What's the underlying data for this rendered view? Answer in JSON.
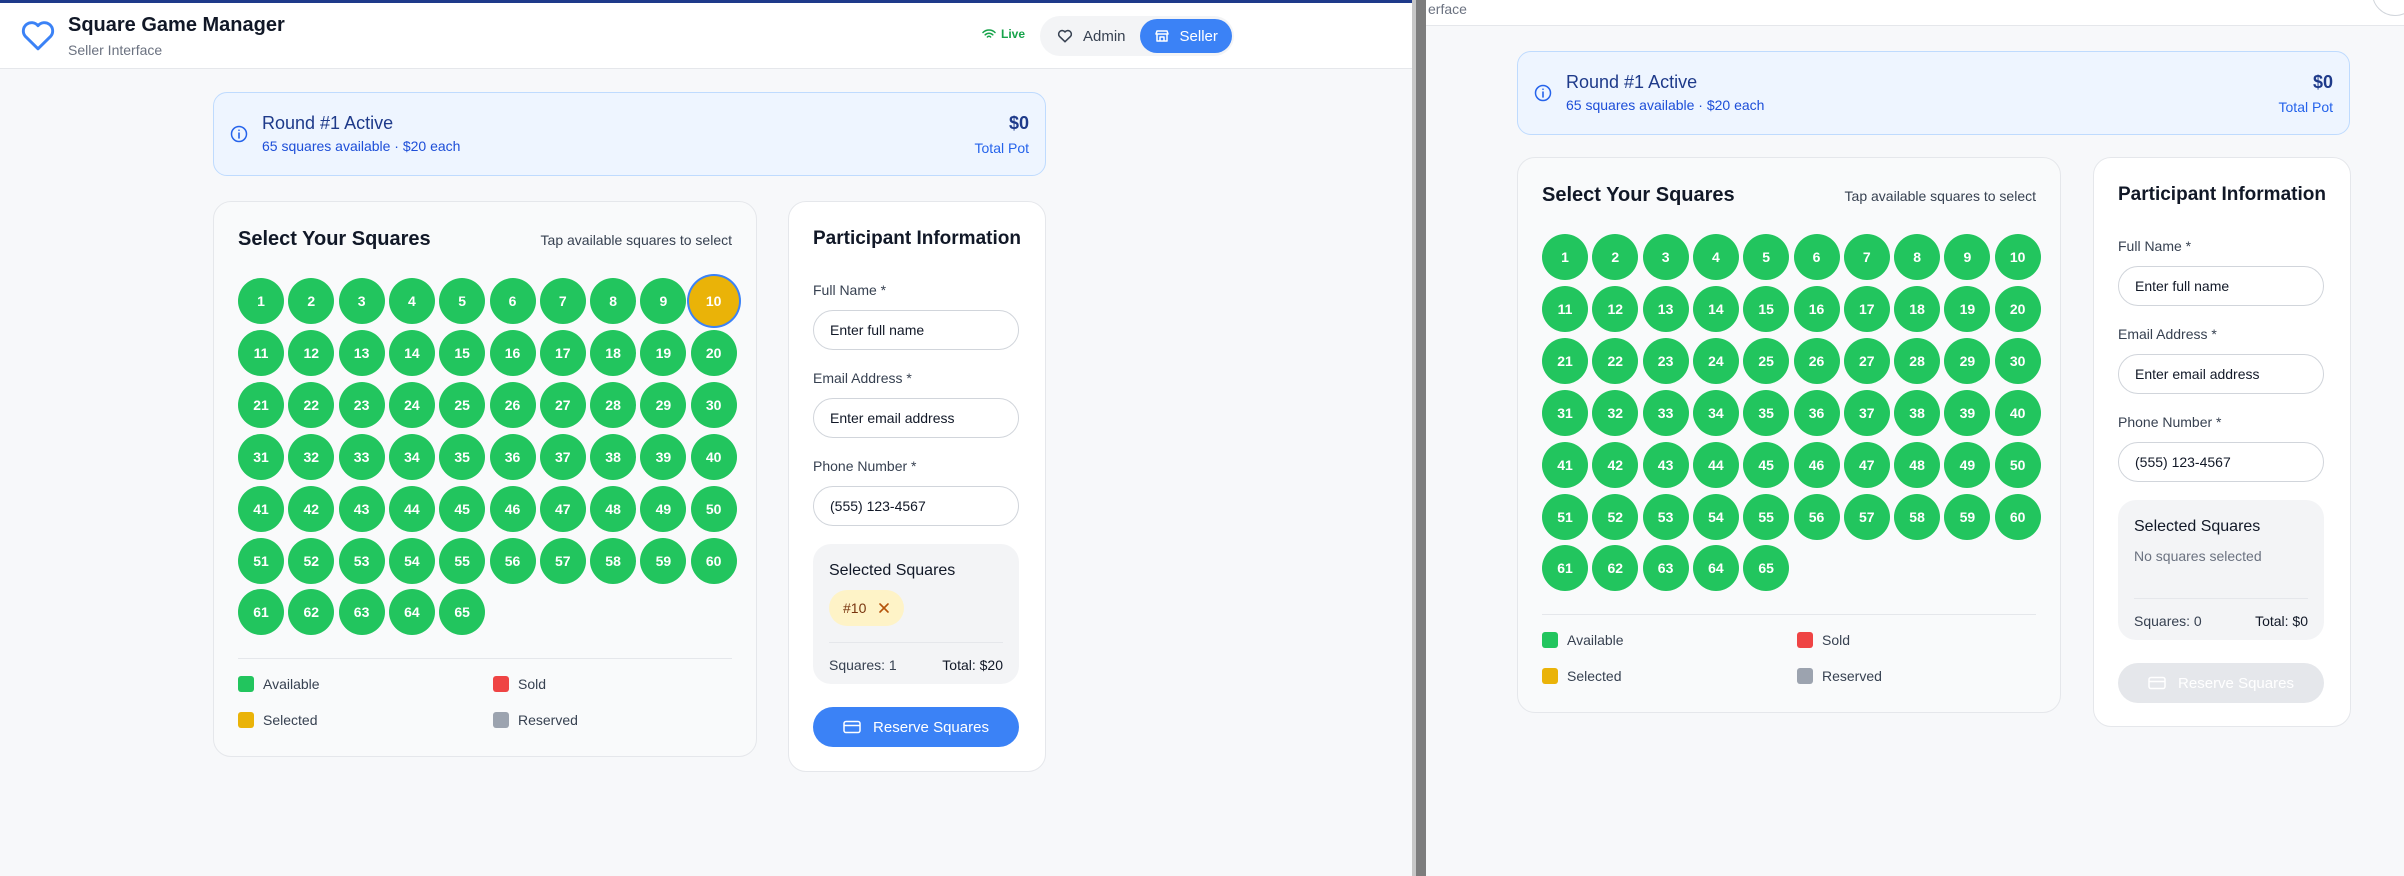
{
  "app": {
    "title": "Square Game Manager",
    "subtitle": "Seller Interface",
    "live": "Live",
    "admin": "Admin",
    "seller": "Seller",
    "strip_text": "erface"
  },
  "round": {
    "title": "Round #1 Active",
    "subtitle": "65 squares available · $20 each",
    "pot": "$0",
    "pot_label": "Total Pot"
  },
  "grid": {
    "title": "Select Your Squares",
    "hint": "Tap available squares to select",
    "total_squares": 65
  },
  "legend": {
    "available": "Available",
    "sold": "Sold",
    "selected": "Selected",
    "reserved": "Reserved"
  },
  "colors": {
    "available": "#22c55e",
    "sold": "#ef4444",
    "selected": "#eab308",
    "reserved": "#9ca3af",
    "accent": "#3b82f6"
  },
  "form": {
    "title": "Participant Information",
    "name_label": "Full Name *",
    "name_placeholder": "Enter full name",
    "email_label": "Email Address *",
    "email_placeholder": "Enter email address",
    "phone_label": "Phone Number *",
    "phone_placeholder": "(555) 123-4567",
    "selected_title": "Selected Squares",
    "reserve_button": "Reserve Squares"
  },
  "left_window": {
    "selected": [
      10
    ],
    "chip": "#10",
    "count": "Squares: 1",
    "total": "Total: $20"
  },
  "right_window": {
    "selected": [],
    "empty": "No squares selected",
    "count": "Squares: 0",
    "total": "Total: $0"
  }
}
